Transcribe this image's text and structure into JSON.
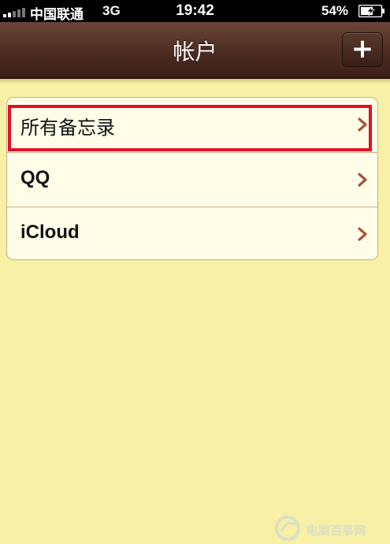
{
  "status_bar": {
    "carrier": "中国联通",
    "network": "3G",
    "time": "19:42",
    "battery": "54%"
  },
  "nav": {
    "title": "帐户",
    "add_label": "+"
  },
  "accounts": [
    {
      "label": "所有备忘录",
      "highlighted": true
    },
    {
      "label": "QQ",
      "highlighted": false
    },
    {
      "label": "iCloud",
      "highlighted": false
    }
  ],
  "watermark": {
    "text": "电脑百事网"
  },
  "colors": {
    "nav_brown": "#4d2c22",
    "paper_yellow": "#f7f0a6",
    "chevron": "#a5553a",
    "highlight_red": "#e0102a"
  }
}
